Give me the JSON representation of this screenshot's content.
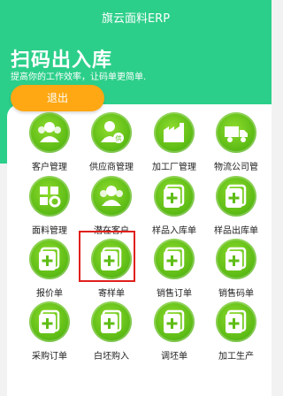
{
  "header": {
    "app_title": "旗云面料ERP",
    "big_title": "扫码出入库",
    "subtitle": "提高你的工作效率，让码单更简单.",
    "logout_label": "退出"
  },
  "menu": [
    {
      "label": "客户管理",
      "icon": "users-icon"
    },
    {
      "label": "供应商管理",
      "icon": "supplier-icon"
    },
    {
      "label": "加工厂管理",
      "icon": "factory-icon"
    },
    {
      "label": "物流公司管",
      "icon": "truck-icon"
    },
    {
      "label": "面料管理",
      "icon": "grid-gear-icon"
    },
    {
      "label": "潜在客户",
      "icon": "users-icon"
    },
    {
      "label": "样品入库单",
      "icon": "add-doc-icon"
    },
    {
      "label": "样品出库单",
      "icon": "add-doc-icon"
    },
    {
      "label": "报价单",
      "icon": "add-doc-icon"
    },
    {
      "label": "寄样单",
      "icon": "add-doc-icon"
    },
    {
      "label": "销售订单",
      "icon": "add-doc-icon"
    },
    {
      "label": "销售码单",
      "icon": "add-doc-icon"
    },
    {
      "label": "采购订单",
      "icon": "add-doc-icon"
    },
    {
      "label": "白坯购入",
      "icon": "add-doc-icon"
    },
    {
      "label": "调坯单",
      "icon": "add-doc-icon"
    },
    {
      "label": "加工生产",
      "icon": "add-doc-icon"
    }
  ],
  "highlighted_item": "寄样单",
  "colors": {
    "header_green": "#2ccf8a",
    "icon_green": "#5fbd16",
    "logout_orange": "#ffa814",
    "highlight_red": "#e0201a"
  }
}
